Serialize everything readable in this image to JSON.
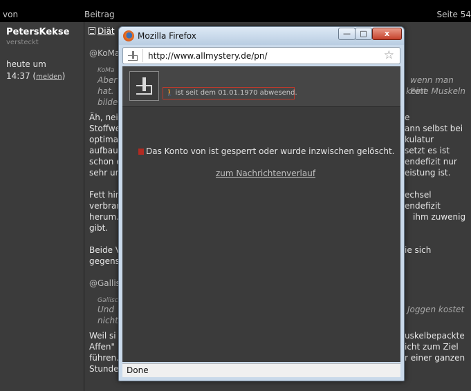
{
  "header": {
    "col_von": "von",
    "col_beitrag": "Beitrag",
    "col_seite": "Seite 54"
  },
  "author": {
    "name": "PetersKekse",
    "status": "versteckt",
    "time_line1": "heute um",
    "time_line2": "14:37",
    "report_link": "melden"
  },
  "post": {
    "title": "Diät",
    "mention1": "@KoMa",
    "quote1_author": "KoMa",
    "quote1_l1_left": "Aber",
    "quote1_l1_right": "wenn man Fett",
    "quote1_l2_left": "hat.",
    "quote1_l2_right": "keine Muskeln",
    "quote1_l3_left": "bilde",
    "p1_l1_left": "Äh, nei",
    "p1_l1_right": "e",
    "p1_l2_left": "Stoffwe",
    "p1_l2_right": "ann selbst bei",
    "p1_l3_left": "optima",
    "p1_l3_right": "kulatur",
    "p1_l4_left": "aufbau",
    "p1_l4_right": "setzt es ist",
    "p1_l5_left": "schon e",
    "p1_l5_right": "endefizit nur",
    "p1_l6_left": "sehr un",
    "p1_l6_right": "eistung ist.",
    "p2_l1_left": "Fett hin",
    "p2_l1_right": "echsel",
    "p2_l2_left": "verbran",
    "p2_l2_right": "endefizit",
    "p2_l3_left": "herum.",
    "p2_l3_right": "ihm zuwenig",
    "p2_l4_left": "gibt.",
    "p3_l1_left": "Beide V",
    "p3_l1_right": "ie sich",
    "p3_l2_left": "gegens",
    "mention2": "@Gallis",
    "quote2_author": "Gallisc",
    "quote2_l1_left": "Und",
    "quote2_l1_right": "Joggen kostet",
    "quote2_l2_left": "nicht",
    "p4_l1_left": "Weil si",
    "p4_l1_right": "uskelbepackte",
    "p4_l2_left": "Affen\"",
    "p4_l2_right": "icht zum Ziel",
    "p4_l3_left": "führen.",
    "p4_l3_right": "r einer ganzen",
    "p4_l4_left": "Stunde"
  },
  "popup": {
    "window_title": "Mozilla Firefox",
    "minimize_glyph": "—",
    "maximize_glyph": "□",
    "close_glyph": "x",
    "url": "http://www.allmystery.de/pn/",
    "absent_text": "ist seit dem 01.01.1970 abwesend.",
    "notice": "Das Konto von ist gesperrt oder wurde inzwischen gelöscht.",
    "history_link": "zum Nachrichtenverlauf",
    "status": "Done"
  },
  "icons": {
    "browser": "firefox-icon",
    "site": "site-favicon-icon",
    "bookmark": "star-icon",
    "absence": "walking-person-icon",
    "blocked": "blocked-icon"
  }
}
